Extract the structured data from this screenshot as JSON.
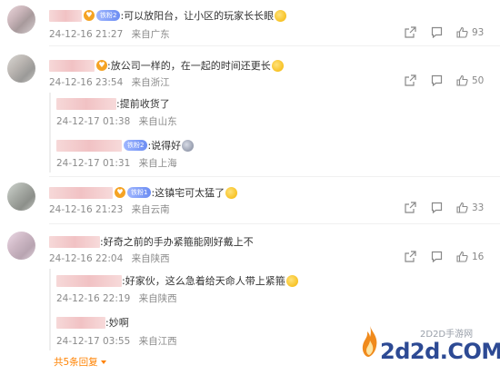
{
  "comments": [
    {
      "text": ":可以放阳台，让小区的玩家长长眼",
      "fan_badge": "铁粉2",
      "time": "24-12-16 21:27",
      "location": "来自广东",
      "likes": "93",
      "emoji": "smile-emoji"
    },
    {
      "text": ":放公司一样的，在一起的时间还更长",
      "time": "24-12-16 23:54",
      "location": "来自浙江",
      "likes": "50",
      "emoji": "smile-emoji",
      "replies": [
        {
          "text": ":提前收货了",
          "time": "24-12-17 01:38",
          "location": "来自山东"
        },
        {
          "text": ":说得好",
          "fan_badge": "铁粉2",
          "time": "24-12-17 01:31",
          "location": "来自上海"
        }
      ]
    },
    {
      "text": ":这镇宅可太猛了",
      "fan_badge": "铁粉1",
      "time": "24-12-16 21:23",
      "location": "来自云南",
      "likes": "33",
      "emoji": "smile-emoji"
    },
    {
      "text": ":好奇之前的手办紧箍能刚好戴上不",
      "time": "24-12-16 22:04",
      "location": "来自陕西",
      "likes": "16",
      "replies": [
        {
          "text": ":好家伙，这么急着给天命人带上紧箍",
          "time": "24-12-16 22:19",
          "location": "来自陕西"
        },
        {
          "text": ":妙啊",
          "time": "24-12-17 03:55",
          "location": "来自江西"
        }
      ]
    }
  ],
  "more_replies": "共5条回复",
  "watermark": {
    "cn": "2D2D手游网",
    "url": "2d2d.COM"
  },
  "colors": {
    "accent": "#ff8200",
    "meta": "#8b8b8b",
    "watermark": "#2d4a94"
  }
}
